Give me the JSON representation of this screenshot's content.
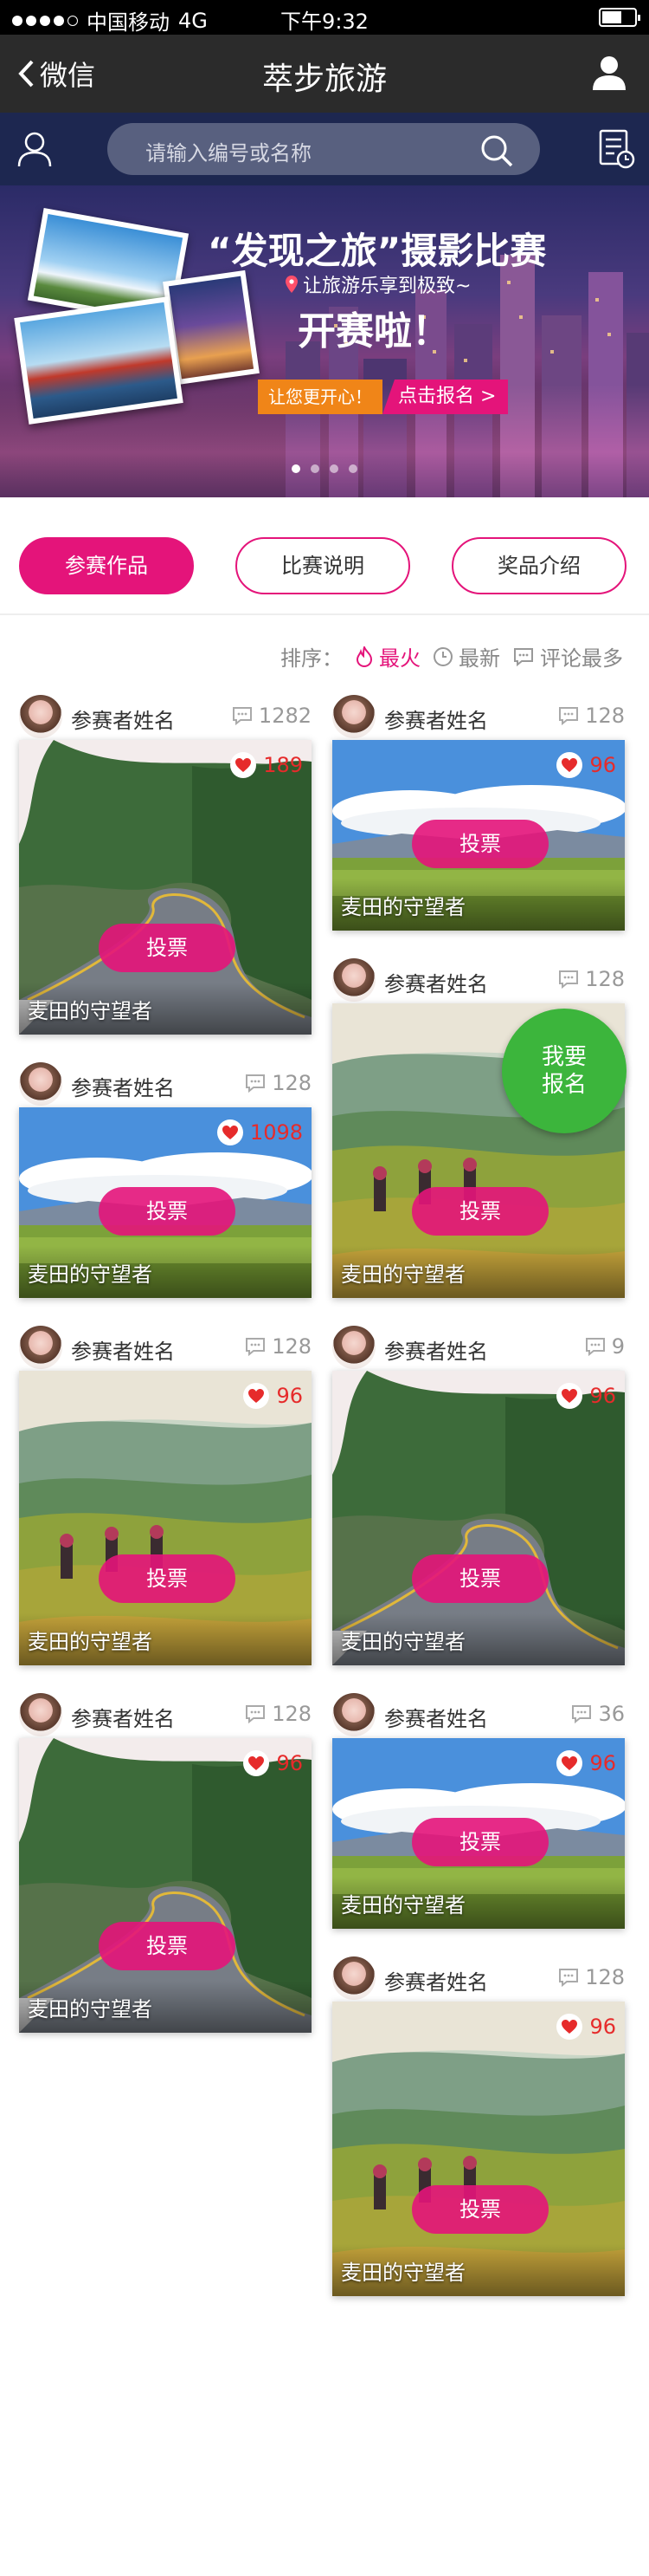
{
  "status": {
    "carrier": "中国移动",
    "network": "4G",
    "time": "下午9:32"
  },
  "nav": {
    "back_label": "微信",
    "title": "萃步旅游"
  },
  "search": {
    "placeholder": "请输入编号或名称"
  },
  "banner": {
    "title": "“发现之旅”摄影比赛",
    "subtitle": "让旅游乐享到极致~",
    "headline": "开赛啦！",
    "tag_left": "让您更开心！",
    "tag_right": "点击报名 >",
    "slides": 4,
    "active_slide": 1
  },
  "tabs": [
    {
      "label": "参赛作品",
      "active": true
    },
    {
      "label": "比赛说明",
      "active": false
    },
    {
      "label": "奖品介绍",
      "active": false
    }
  ],
  "sort": {
    "label": "排序：",
    "options": [
      "最火",
      "最新",
      "评论最多"
    ],
    "active": "最火"
  },
  "fab": {
    "line1": "我要",
    "line2": "报名"
  },
  "left_cards": [
    {
      "name": "参赛者姓名",
      "comments": "1282",
      "likes": "189",
      "vote": "投票",
      "caption": "麦田的守望者",
      "scene": "road"
    },
    {
      "name": "参赛者姓名",
      "comments": "128",
      "likes": "1098",
      "vote": "投票",
      "caption": "麦田的守望者",
      "scene": "field"
    },
    {
      "name": "参赛者姓名",
      "comments": "128",
      "likes": "96",
      "vote": "投票",
      "caption": "麦田的守望者",
      "scene": "terrace"
    },
    {
      "name": "参赛者姓名",
      "comments": "128",
      "likes": "96",
      "vote": "投票",
      "caption": "麦田的守望者",
      "scene": "road"
    }
  ],
  "right_cards": [
    {
      "name": "参赛者姓名",
      "comments": "128",
      "likes": "96",
      "vote": "投票",
      "caption": "麦田的守望者",
      "scene": "field"
    },
    {
      "name": "参赛者姓名",
      "comments": "128",
      "likes": "",
      "vote": "投票",
      "caption": "麦田的守望者",
      "scene": "terrace"
    },
    {
      "name": "参赛者姓名",
      "comments": "9",
      "likes": "96",
      "vote": "投票",
      "caption": "麦田的守望者",
      "scene": "road"
    },
    {
      "name": "参赛者姓名",
      "comments": "36",
      "likes": "96",
      "vote": "投票",
      "caption": "麦田的守望者",
      "scene": "field"
    },
    {
      "name": "参赛者姓名",
      "comments": "128",
      "likes": "96",
      "vote": "投票",
      "caption": "麦田的守望者",
      "scene": "terrace"
    }
  ],
  "colors": {
    "accent": "#e4147a",
    "heart": "#e62b2b",
    "nav_bg": "#2b2b2b",
    "search_bg": "#1d2750",
    "fab": "#3cb53c"
  }
}
